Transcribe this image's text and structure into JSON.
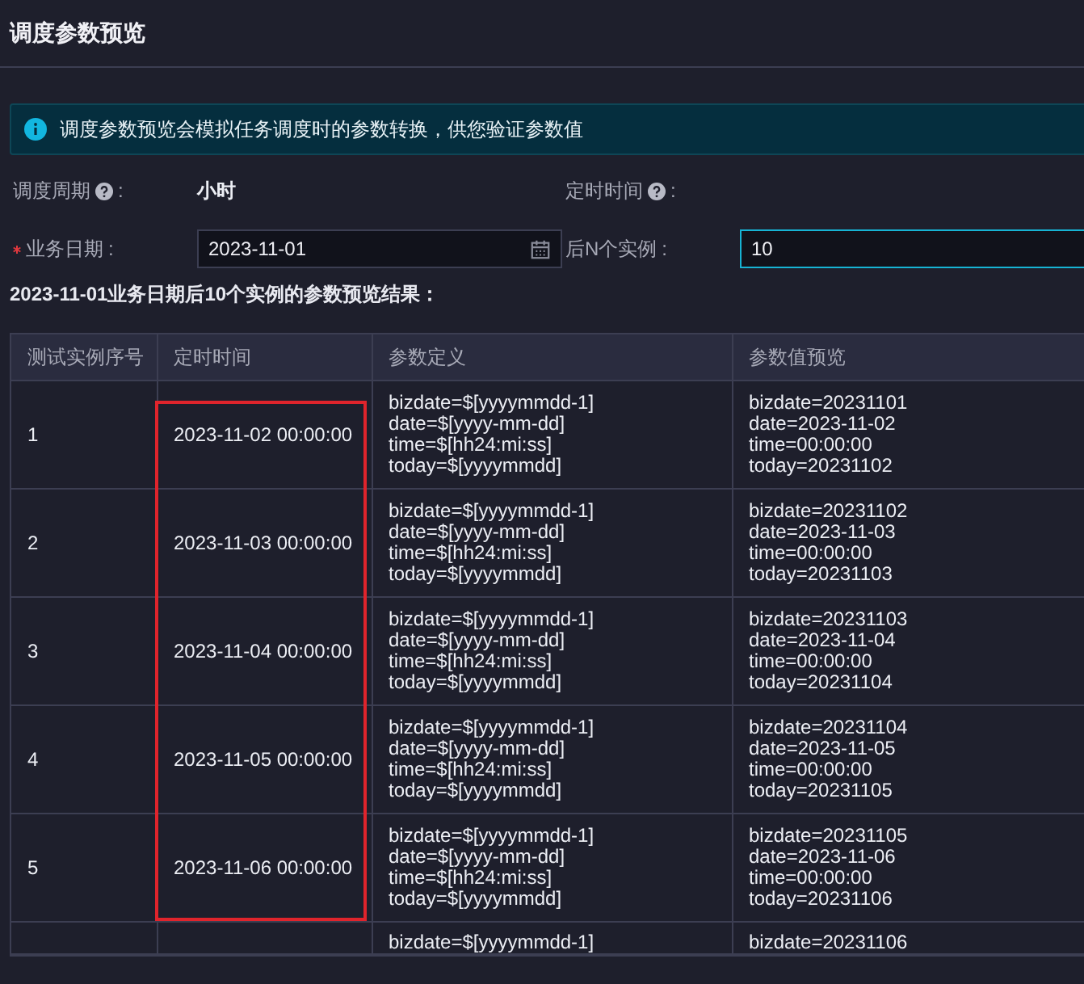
{
  "title": "调度参数预览",
  "alert": {
    "text": "调度参数预览会模拟任务调度时的参数转换，供您验证参数值"
  },
  "form": [
    {
      "label": "调度周期",
      "colon": ":",
      "required": false,
      "help": true,
      "kind": "text",
      "value": "小时"
    },
    {
      "label": "定时时间",
      "colon": ":",
      "required": false,
      "help": true,
      "kind": "text"
    },
    {
      "label": "业务日期",
      "colon": ":",
      "required": true,
      "help": false,
      "kind": "date",
      "value": "2023-11-01",
      "focused": false
    },
    {
      "label": "后N个实例",
      "colon": ":",
      "required": false,
      "help": false,
      "kind": "input",
      "value": "10",
      "focused": true
    }
  ],
  "result_label": "2023-11-01业务日期后10个实例的参数预览结果：",
  "table": {
    "columns": [
      "测试实例序号",
      "定时时间",
      "参数定义",
      "参数值预览"
    ],
    "rows": [
      {
        "index": "1",
        "time": "2023-11-02 00:00:00",
        "highlighted": true,
        "definition": [
          "bizdate=$[yyyymmdd-1]",
          "date=$[yyyy-mm-dd]",
          "time=$[hh24:mi:ss]",
          "today=$[yyyymmdd]"
        ],
        "preview": [
          "bizdate=20231101",
          "date=2023-11-02",
          "time=00:00:00",
          "today=20231102"
        ]
      },
      {
        "index": "2",
        "time": "2023-11-03 00:00:00",
        "highlighted": true,
        "definition": [
          "bizdate=$[yyyymmdd-1]",
          "date=$[yyyy-mm-dd]",
          "time=$[hh24:mi:ss]",
          "today=$[yyyymmdd]"
        ],
        "preview": [
          "bizdate=20231102",
          "date=2023-11-03",
          "time=00:00:00",
          "today=20231103"
        ]
      },
      {
        "index": "3",
        "time": "2023-11-04 00:00:00",
        "highlighted": true,
        "definition": [
          "bizdate=$[yyyymmdd-1]",
          "date=$[yyyy-mm-dd]",
          "time=$[hh24:mi:ss]",
          "today=$[yyyymmdd]"
        ],
        "preview": [
          "bizdate=20231103",
          "date=2023-11-04",
          "time=00:00:00",
          "today=20231104"
        ]
      },
      {
        "index": "4",
        "time": "2023-11-05 00:00:00",
        "highlighted": true,
        "definition": [
          "bizdate=$[yyyymmdd-1]",
          "date=$[yyyy-mm-dd]",
          "time=$[hh24:mi:ss]",
          "today=$[yyyymmdd]"
        ],
        "preview": [
          "bizdate=20231104",
          "date=2023-11-05",
          "time=00:00:00",
          "today=20231105"
        ]
      },
      {
        "index": "5",
        "time": "2023-11-06 00:00:00",
        "highlighted": true,
        "definition": [
          "bizdate=$[yyyymmdd-1]",
          "date=$[yyyy-mm-dd]",
          "time=$[hh24:mi:ss]",
          "today=$[yyyymmdd]"
        ],
        "preview": [
          "bizdate=20231105",
          "date=2023-11-06",
          "time=00:00:00",
          "today=20231106"
        ]
      },
      {
        "highlighted": false,
        "definition": [
          "bizdate=$[yyyymmdd-1]"
        ],
        "preview": [
          "bizdate=20231106"
        ]
      }
    ]
  }
}
